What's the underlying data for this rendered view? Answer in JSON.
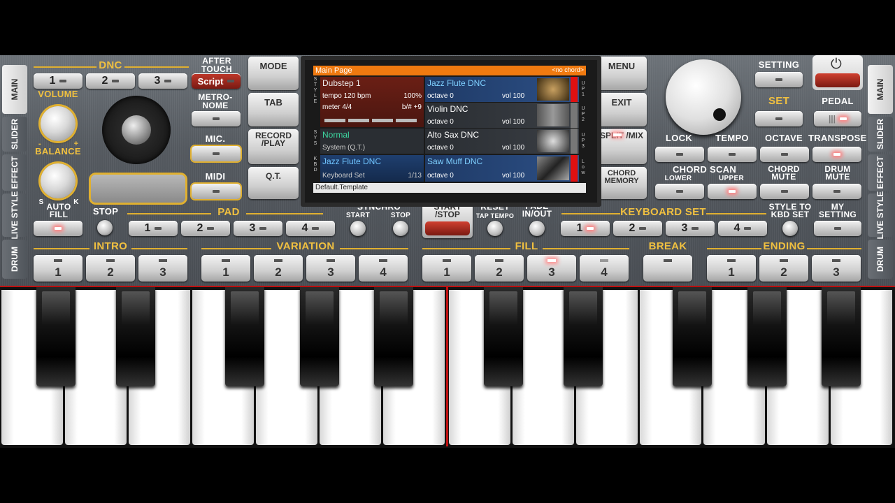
{
  "side_tabs_left": [
    "MAIN",
    "SLIDER",
    "EFFECT",
    "LIVE STYLE",
    "DRUM"
  ],
  "side_tabs_right": [
    "MAIN",
    "SLIDER",
    "EFFECT",
    "LIVE STYLE",
    "DRUM"
  ],
  "dnc": {
    "label": "DNC",
    "buttons": [
      "1",
      "2",
      "3"
    ]
  },
  "after_touch": {
    "label": "AFTER TOUCH",
    "button": "Script"
  },
  "metronome": "METRO-NOME",
  "mic": "MIC.",
  "midi": "MIDI",
  "volume": "VOLUME",
  "balance": "BALANCE",
  "balance_s": "S",
  "balance_k": "K",
  "minus": "-",
  "plus": "+",
  "mode": "MODE",
  "tab": "TAB",
  "record_play": "RECORD /PLAY",
  "qt": "Q.T.",
  "menu": "MENU",
  "exit": "EXIT",
  "split_mix": "SPLIT /MIX",
  "chord_memory": "CHORD MEMORY",
  "setting": "SETTING",
  "set": "SET",
  "pedal": "PEDAL",
  "lock": "LOCK",
  "tempo": "TEMPO",
  "octave": "OCTAVE",
  "transpose": "TRANSPOSE",
  "chord_scan": {
    "label": "CHORD SCAN",
    "lower": "LOWER",
    "upper": "UPPER"
  },
  "chord_mute": "CHORD MUTE",
  "drum_mute": "DRUM MUTE",
  "auto_fill": "AUTO FILL",
  "stop": "STOP",
  "pad": {
    "label": "PAD",
    "buttons": [
      "1",
      "2",
      "3",
      "4"
    ]
  },
  "synchro": {
    "label": "SYNCHRO",
    "start": "START",
    "stop": "STOP"
  },
  "start_stop": "START /STOP",
  "reset": {
    "label": "RESET",
    "sub": "TAP TEMPO"
  },
  "fade": "FADE IN/OUT",
  "keyboard_set": {
    "label": "KEYBOARD SET",
    "buttons": [
      "1",
      "2",
      "3",
      "4"
    ]
  },
  "style_to_kbd": "STYLE TO KBD SET",
  "my_setting": "MY SETTING",
  "intro": {
    "label": "INTRO",
    "buttons": [
      "1",
      "2",
      "3"
    ]
  },
  "variation": {
    "label": "VARIATION",
    "buttons": [
      "1",
      "2",
      "3",
      "4"
    ]
  },
  "fill": {
    "label": "FILL",
    "buttons": [
      "1",
      "2",
      "3",
      "4"
    ]
  },
  "break": "BREAK",
  "ending": {
    "label": "ENDING",
    "buttons": [
      "1",
      "2",
      "3"
    ]
  },
  "screen": {
    "title": "Main Page",
    "chord": "<no chord>",
    "style_name": "Dubstep 1",
    "tempo": "tempo 120 bpm",
    "tempo_pct": "100%",
    "meter": "meter 4/4",
    "key": "b/# +9",
    "sys_name": "Normal",
    "sys_sub": "System (Q.T.)",
    "kbd_name": "Jazz Flute DNC",
    "kbd_sub": "Keyboard Set",
    "kbd_count": "1/13",
    "footer": "Default.Template",
    "side_style": "S T Y L E",
    "side_sys": "S Y S",
    "side_kbd": "K B D",
    "voices": [
      {
        "name": "Jazz Flute DNC",
        "octave": "octave 0",
        "vol": "vol 100",
        "tag": "U P 1"
      },
      {
        "name": "Violin DNC",
        "octave": "octave 0",
        "vol": "vol 100",
        "tag": "U P 2"
      },
      {
        "name": "Alto Sax DNC",
        "octave": "octave 0",
        "vol": "vol 100",
        "tag": "U P 3"
      },
      {
        "name": "Saw Muff DNC",
        "octave": "octave 0",
        "vol": "vol 100",
        "tag": "L o w"
      }
    ]
  }
}
